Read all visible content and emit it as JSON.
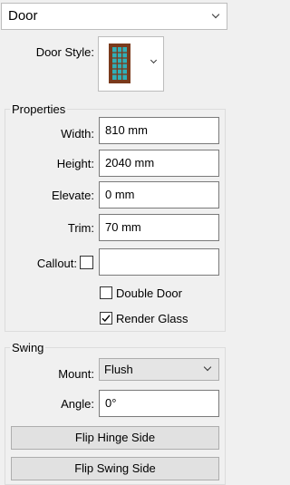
{
  "type_select": {
    "value": "Door"
  },
  "door_style": {
    "label": "Door Style:",
    "thumbnail_icon": "door-thumbnail-icon"
  },
  "properties": {
    "title": "Properties",
    "width": {
      "label": "Width:",
      "value": "810 mm"
    },
    "height": {
      "label": "Height:",
      "value": "2040 mm"
    },
    "elevate": {
      "label": "Elevate:",
      "value": "0 mm"
    },
    "trim": {
      "label": "Trim:",
      "value": "70 mm"
    },
    "callout": {
      "label": "Callout:",
      "checked": false,
      "value": ""
    },
    "double_door": {
      "label": "Double Door",
      "checked": false
    },
    "render_glass": {
      "label": "Render Glass",
      "checked": true
    }
  },
  "swing": {
    "title": "Swing",
    "mount": {
      "label": "Mount:",
      "value": "Flush"
    },
    "angle": {
      "label": "Angle:",
      "value": "0°"
    },
    "flip_hinge_label": "Flip Hinge Side",
    "flip_swing_label": "Flip Swing Side"
  },
  "colors": {
    "door_frame": "#7a3a1c",
    "door_glass": "#2fb0b8"
  }
}
